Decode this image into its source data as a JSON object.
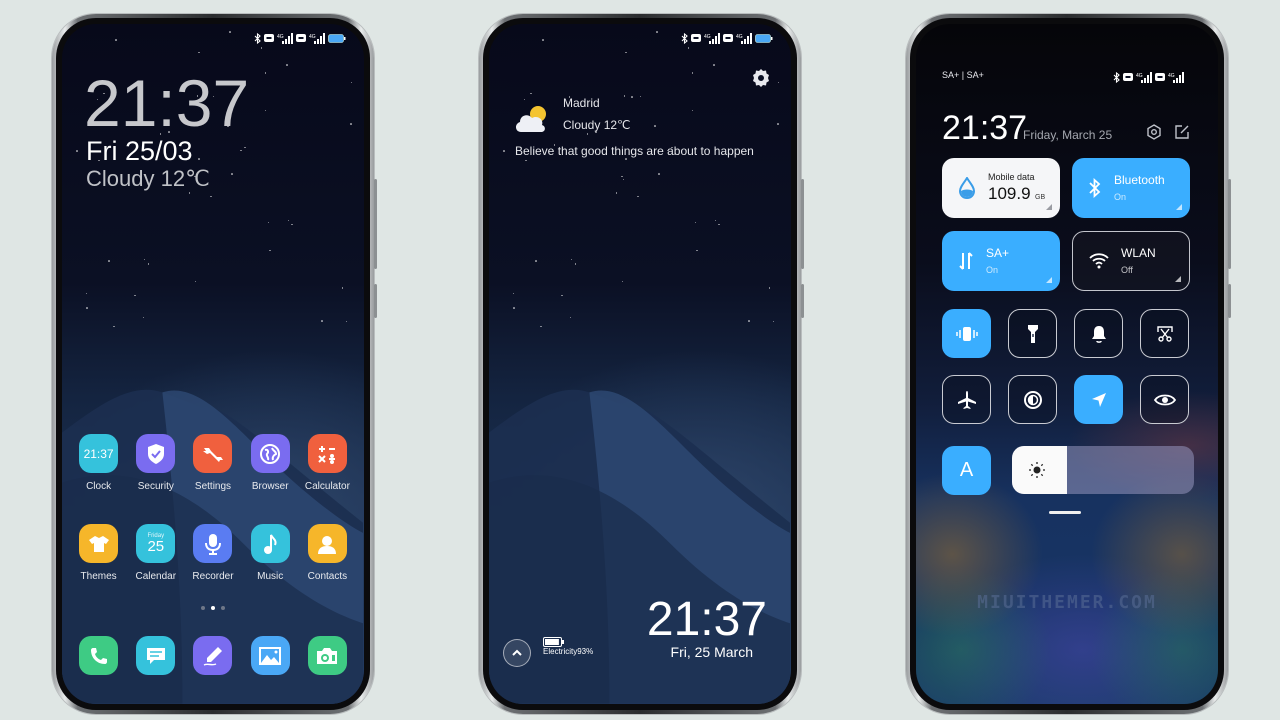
{
  "status_bar": {
    "icons": [
      "bluetooth-icon",
      "hd-icon",
      "signal-4g-icon",
      "hd-icon",
      "signal-4g-icon",
      "battery-icon"
    ],
    "network_label": "4G"
  },
  "home_screen": {
    "clock": "21:37",
    "date": "Fri 25/03",
    "weather": "Cloudy 12℃",
    "apps_row1": [
      {
        "label": "Clock",
        "icon": "clock-icon",
        "color": "#35c2dc",
        "icon_text": "21:37"
      },
      {
        "label": "Security",
        "icon": "shield-check-icon",
        "color": "#7a6cf0"
      },
      {
        "label": "Settings",
        "icon": "wrench-icon",
        "color": "#f0603e"
      },
      {
        "label": "Browser",
        "icon": "globe-icon",
        "color": "#7a6cf0"
      },
      {
        "label": "Calculator",
        "icon": "calculator-icon",
        "color": "#f0603e"
      }
    ],
    "apps_row2": [
      {
        "label": "Themes",
        "icon": "tshirt-icon",
        "color": "#f6b62a"
      },
      {
        "label": "Calendar",
        "icon": "calendar-icon",
        "color": "#35c2dc",
        "icon_day": "Friday",
        "icon_date": "25"
      },
      {
        "label": "Recorder",
        "icon": "microphone-icon",
        "color": "#5a7cf2"
      },
      {
        "label": "Music",
        "icon": "music-note-icon",
        "color": "#35c2dc"
      },
      {
        "label": "Contacts",
        "icon": "person-icon",
        "color": "#f6b62a"
      }
    ],
    "page_count": 3,
    "active_page": 2,
    "dock": [
      {
        "name": "phone",
        "icon": "phone-icon",
        "color": "#3ecb84"
      },
      {
        "name": "messages",
        "icon": "message-icon",
        "color": "#35c2dc"
      },
      {
        "name": "notes",
        "icon": "pen-icon",
        "color": "#7a6cf0"
      },
      {
        "name": "gallery",
        "icon": "image-icon",
        "color": "#4aa8f6"
      },
      {
        "name": "camera",
        "icon": "camera-icon",
        "color": "#3ecb84"
      }
    ]
  },
  "lock_screen": {
    "city": "Madrid",
    "condition": "Cloudy  12℃",
    "quote": "Believe that good things are about to happen",
    "clock": "21:37",
    "date": "Fri, 25 March",
    "battery_text": "Electricity93%",
    "battery_percent": 93
  },
  "control_center": {
    "carrier": "SA+ | SA+",
    "clock": "21:37",
    "date": "Friday, March 25",
    "tiles": {
      "mobile_data": {
        "title": "Mobile data",
        "value": "109.9",
        "unit": "GB"
      },
      "bluetooth": {
        "title": "Bluetooth",
        "state": "On"
      },
      "sa": {
        "title": "SA+",
        "state": "On"
      },
      "wlan": {
        "title": "WLAN",
        "state": "Off"
      }
    },
    "toggles": [
      {
        "name": "vibrate",
        "icon": "vibrate-icon",
        "on": true
      },
      {
        "name": "flashlight",
        "icon": "flashlight-icon",
        "on": false
      },
      {
        "name": "sound",
        "icon": "bell-icon",
        "on": false
      },
      {
        "name": "screenshot",
        "icon": "scissors-screenshot-icon",
        "on": false
      },
      {
        "name": "airplane-mode",
        "icon": "airplane-icon",
        "on": false
      },
      {
        "name": "dark-mode",
        "icon": "contrast-icon",
        "on": false
      },
      {
        "name": "location",
        "icon": "location-arrow-icon",
        "on": true
      },
      {
        "name": "reading-mode",
        "icon": "eye-icon",
        "on": false
      }
    ],
    "auto_brightness_label": "A",
    "brightness_percent": 30,
    "watermark": "MIUITHEMER.COM"
  }
}
